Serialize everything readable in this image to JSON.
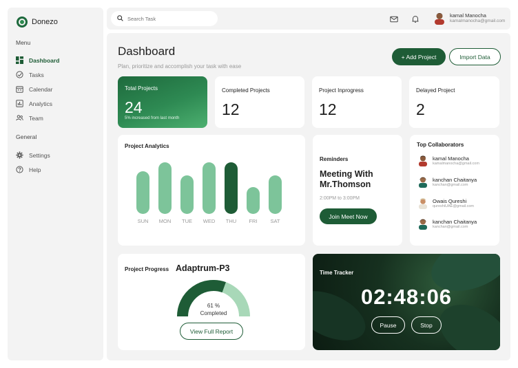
{
  "app": {
    "name": "Donezo"
  },
  "sidebar": {
    "menu_label": "Menu",
    "general_label": "General",
    "menu": [
      {
        "label": "Dashboard",
        "icon": "grid-icon",
        "active": true
      },
      {
        "label": "Tasks",
        "icon": "tasks-icon"
      },
      {
        "label": "Calendar",
        "icon": "calendar-icon"
      },
      {
        "label": "Analytics",
        "icon": "chart-icon"
      },
      {
        "label": "Team",
        "icon": "team-icon"
      }
    ],
    "general": [
      {
        "label": "Settings",
        "icon": "gear-icon"
      },
      {
        "label": "Help",
        "icon": "help-icon"
      }
    ]
  },
  "topbar": {
    "search_placeholder": "Search Task",
    "user_name": "kamal Manocha",
    "user_email": "kamalmanocha@gmail.com"
  },
  "header": {
    "title": "Dashboard",
    "subtitle": "Plan, prioritize and accomplish your task with ease",
    "add_button": "+ Add Project",
    "import_button": "Import Data"
  },
  "stats": [
    {
      "title": "Total Projects",
      "value": "24",
      "note": "5% increased from last month"
    },
    {
      "title": "Completed Projects",
      "value": "12"
    },
    {
      "title": "Project Inprogress",
      "value": "12"
    },
    {
      "title": "Delayed Project",
      "value": "2"
    }
  ],
  "analytics": {
    "title": "Project Analytics",
    "days": [
      "SUN",
      "MON",
      "TUE",
      "WED",
      "THU",
      "FRI",
      "SAT"
    ],
    "levels": [
      0.83,
      1.0,
      0.74,
      1.0,
      1.0,
      0.52,
      0.74
    ],
    "highlight": "THU"
  },
  "reminders": {
    "title": "Reminders",
    "meeting": "Meeting With Mr.Thomson",
    "time": "2:00PM to 3:00PM",
    "button": "Join Meet Now"
  },
  "collaborators": {
    "title": "Top Collaborators",
    "people": [
      {
        "name": "kamal Manocha",
        "email": "kamalmanocha@gmail.com"
      },
      {
        "name": "kanchan Chaitanya",
        "email": "kanchan@gmail.com"
      },
      {
        "name": "Owais Qureshi",
        "email": "qureshiUAE@gmail.com"
      },
      {
        "name": "kanchan Chaitanya",
        "email": "kanchan@gmail.com"
      }
    ]
  },
  "progress": {
    "label": "Project Progress",
    "project": "Adaptrum-P3",
    "percent_text": "61 %",
    "completed_label": "Completed",
    "percent": 61,
    "button": "View Full Report"
  },
  "tracker": {
    "title": "Time Tracker",
    "time": "02:48:06",
    "pause": "Pause",
    "stop": "Stop"
  },
  "colors": {
    "primary": "#1e5c36",
    "bar_light": "#7dc49a",
    "accent": "#2e8a53"
  }
}
